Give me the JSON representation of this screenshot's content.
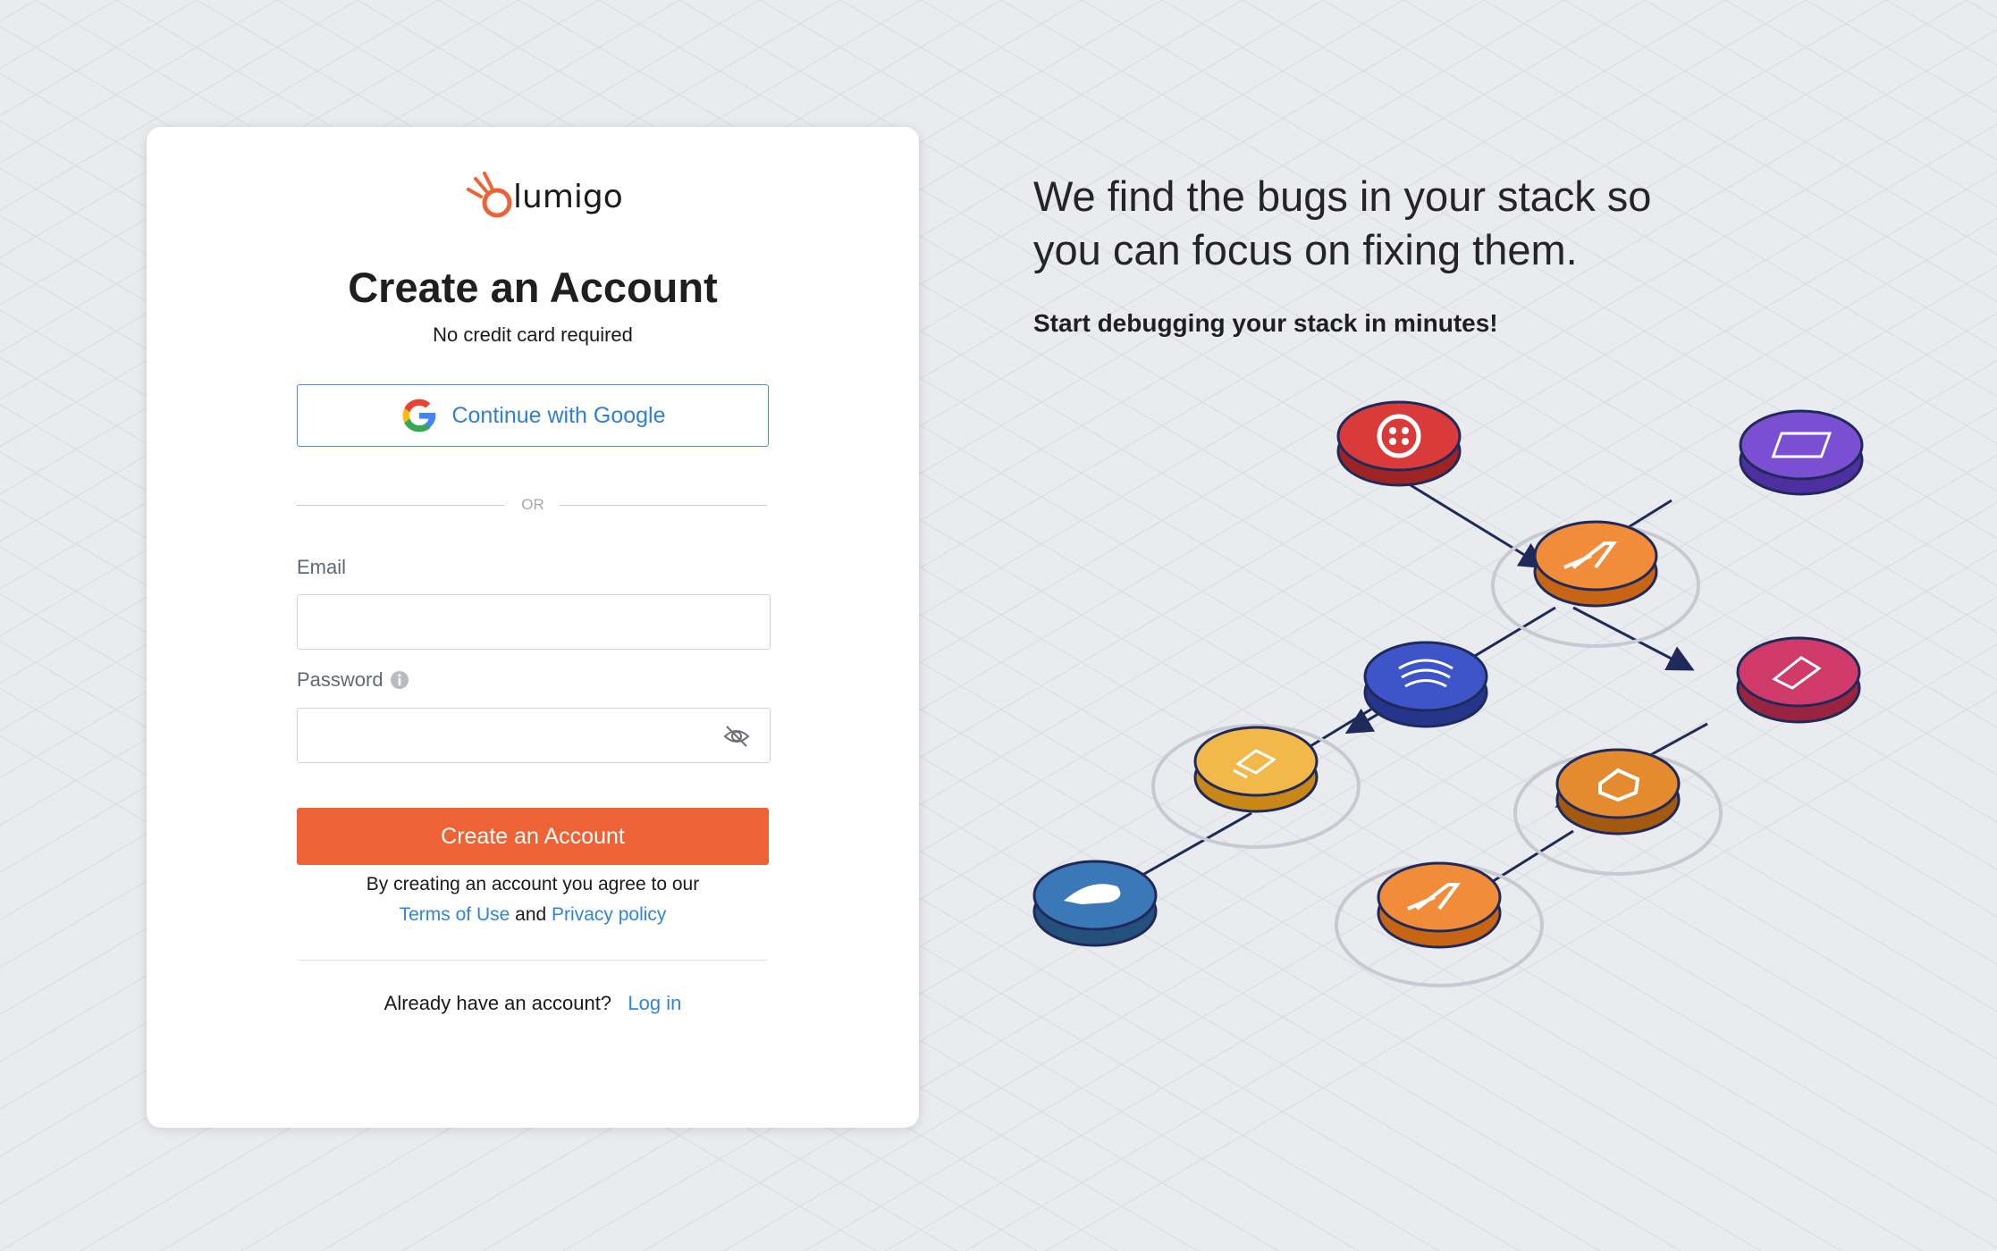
{
  "brand": {
    "name": "lumigo",
    "accent": "#ee6335",
    "link": "#2f86d8"
  },
  "form": {
    "title": "Create an Account",
    "subtitle": "No credit card required",
    "google_label": "Continue with Google",
    "or_text": "OR",
    "email_label": "Email",
    "email_value": "",
    "password_label": "Password",
    "password_value": "",
    "submit_label": "Create an Account",
    "agree_prefix": "By creating an account you agree to our",
    "terms_link": "Terms of Use",
    "and_text": "and",
    "privacy_link": "Privacy policy",
    "have_account": "Already have an account?",
    "login_link": "Log in"
  },
  "promo": {
    "headline_line1": "We find the bugs in your stack so",
    "headline_line2": "you can focus on fixing them.",
    "tagline": "Start debugging your stack in minutes!"
  },
  "icons": [
    "google-icon",
    "info-icon",
    "eye-off-icon",
    "lumigo-logo-icon"
  ],
  "diagram_nodes": [
    {
      "name": "twilio-node",
      "color": "#d93b3b"
    },
    {
      "name": "lambda-node-top",
      "color": "#f08c3a"
    },
    {
      "name": "purple-service-node",
      "color": "#7a4fd1"
    },
    {
      "name": "blue-stream-node",
      "color": "#3d55c8"
    },
    {
      "name": "pink-service-node",
      "color": "#d03a6a"
    },
    {
      "name": "yellow-database-node",
      "color": "#f2b84a"
    },
    {
      "name": "step-functions-node",
      "color": "#e48a2f"
    },
    {
      "name": "shopify-blue-node",
      "color": "#3b78b8"
    },
    {
      "name": "lambda-node-bottom",
      "color": "#f08c3a"
    }
  ]
}
